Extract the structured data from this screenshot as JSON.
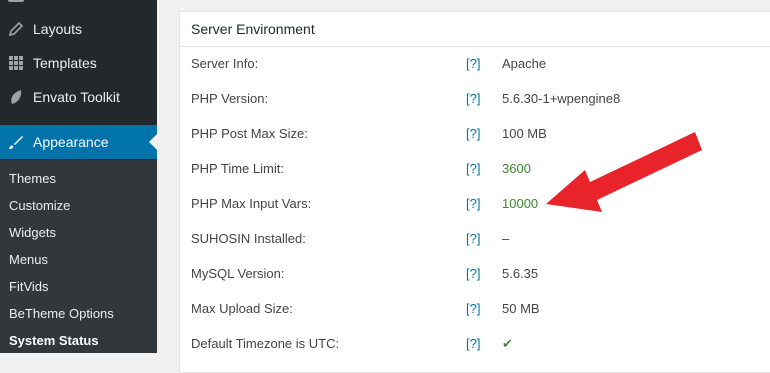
{
  "sidebar": {
    "menu": [
      {
        "label": "Layouts",
        "icon": "pencil-icon"
      },
      {
        "label": "Templates",
        "icon": "grid-icon"
      },
      {
        "label": "Envato Toolkit",
        "icon": "leaf-icon"
      },
      {
        "label": "Appearance",
        "icon": "paintbrush-icon"
      }
    ],
    "submenu": [
      "Themes",
      "Customize",
      "Widgets",
      "Menus",
      "FitVids",
      "BeTheme Options",
      "System Status"
    ]
  },
  "panel": {
    "title": "Server Environment",
    "help_label": "[?]",
    "rows": [
      {
        "label": "Server Info:",
        "value": "Apache",
        "status": "normal"
      },
      {
        "label": "PHP Version:",
        "value": "5.6.30-1+wpengine8",
        "status": "normal"
      },
      {
        "label": "PHP Post Max Size:",
        "value": "100 MB",
        "status": "normal"
      },
      {
        "label": "PHP Time Limit:",
        "value": "3600",
        "status": "ok"
      },
      {
        "label": "PHP Max Input Vars:",
        "value": "10000",
        "status": "ok"
      },
      {
        "label": "SUHOSIN Installed:",
        "value": "–",
        "status": "normal"
      },
      {
        "label": "MySQL Version:",
        "value": "5.6.35",
        "status": "normal"
      },
      {
        "label": "Max Upload Size:",
        "value": "50 MB",
        "status": "normal"
      },
      {
        "label": "Default Timezone is UTC:",
        "value": "✔",
        "status": "ok"
      }
    ]
  },
  "colors": {
    "sidebar_bg": "#23282d",
    "submenu_bg": "#32373c",
    "active_bg": "#0073aa",
    "ok_green": "#3c8a2e",
    "arrow_red": "#e8232a"
  }
}
